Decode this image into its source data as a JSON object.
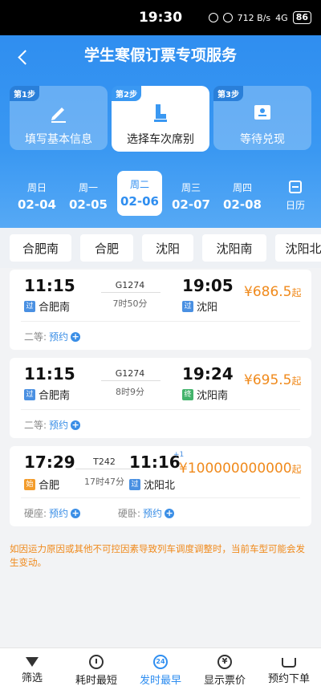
{
  "status_bar": {
    "time": "19:30",
    "battery": "86",
    "net": "712 B/s",
    "signal": "4G"
  },
  "header": {
    "title": "学生寒假订票专项服务"
  },
  "steps": [
    {
      "tag": "第1步",
      "label": "填写基本信息",
      "icon": "pencil-icon"
    },
    {
      "tag": "第2步",
      "label": "选择车次席别",
      "icon": "seat-icon"
    },
    {
      "tag": "第3步",
      "label": "等待兑现",
      "icon": "ticket-icon"
    }
  ],
  "dates": [
    {
      "week": "周日",
      "date": "02-04"
    },
    {
      "week": "周一",
      "date": "02-05"
    },
    {
      "week": "周二",
      "date": "02-06"
    },
    {
      "week": "周三",
      "date": "02-07"
    },
    {
      "week": "周四",
      "date": "02-08"
    }
  ],
  "calendar_label": "日历",
  "stations": [
    "合肥南",
    "合肥",
    "沈阳",
    "沈阳南",
    "沈阳北"
  ],
  "trains": [
    {
      "depart_time": "11:15",
      "arrive_time": "19:05",
      "train_no": "G1274",
      "duration": "7时50分",
      "from_badge": "过",
      "from": "合肥南",
      "to_badge": "过",
      "to": "沈阳",
      "price": "¥686.5",
      "price_suffix": "起",
      "seats": [
        {
          "name": "二等:",
          "action": "预约"
        }
      ]
    },
    {
      "depart_time": "11:15",
      "arrive_time": "19:24",
      "train_no": "G1274",
      "duration": "8时9分",
      "from_badge": "过",
      "from": "合肥南",
      "to_badge": "终",
      "to": "沈阳南",
      "price": "¥695.5",
      "price_suffix": "起",
      "seats": [
        {
          "name": "二等:",
          "action": "预约"
        }
      ]
    },
    {
      "depart_time": "17:29",
      "arrive_time": "11:16",
      "arrive_plus": "+1",
      "train_no": "T242",
      "duration": "17时47分",
      "from_badge": "始",
      "from": "合肥",
      "to_badge": "过",
      "to": "沈阳北",
      "price": "¥100000000000",
      "price_suffix": "起",
      "seats": [
        {
          "name": "硬座:",
          "action": "预约"
        },
        {
          "name": "硬卧:",
          "action": "预约"
        }
      ]
    }
  ],
  "notice": "如因运力原因或其他不可控因素导致列车调度调整时，当前车型可能会发生变动。",
  "bottom_bar": [
    {
      "label": "筛选",
      "icon": "filter-icon"
    },
    {
      "label": "耗时最短",
      "icon": "clock-icon"
    },
    {
      "label": "发时最早",
      "icon": "clock-24-icon",
      "icon_text": "24"
    },
    {
      "label": "显示票价",
      "icon": "yen-icon",
      "icon_text": "¥"
    },
    {
      "label": "预约下单",
      "icon": "cart-icon"
    }
  ]
}
